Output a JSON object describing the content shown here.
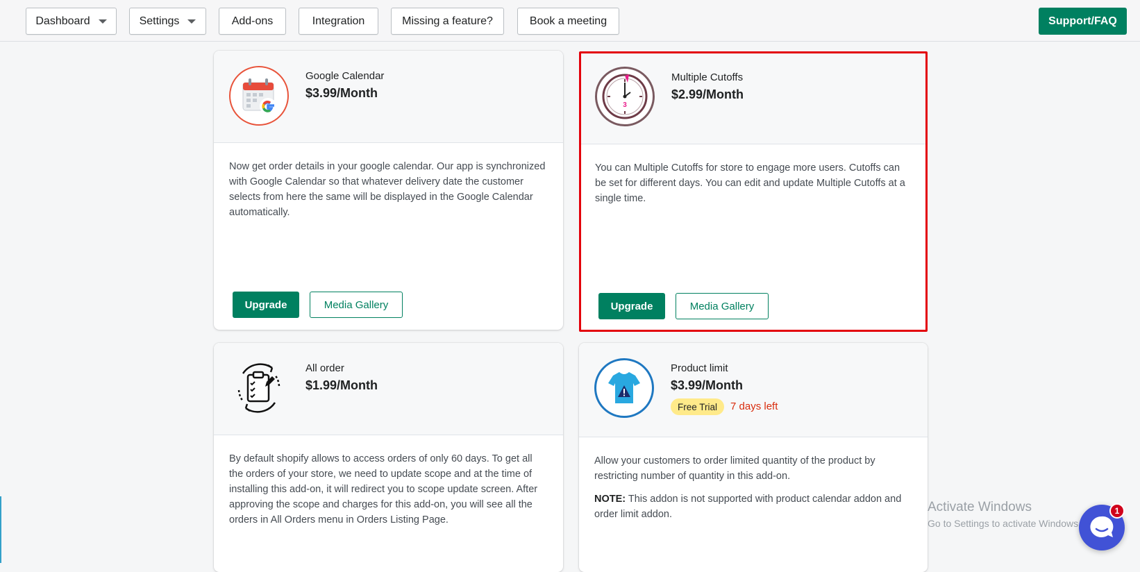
{
  "nav": {
    "dashboard": "Dashboard",
    "settings": "Settings",
    "addons": "Add-ons",
    "integration": "Integration",
    "missing_feature": "Missing a feature?",
    "book_meeting": "Book a meeting",
    "support": "Support/FAQ"
  },
  "cards": [
    {
      "title": "Google Calendar",
      "price": "$3.99/Month",
      "description": "Now get order details in your google calendar. Our app is synchronized with Google Calendar so that whatever delivery date the customer selects from here the same will be displayed in the Google Calendar automatically.",
      "upgrade_label": "Upgrade",
      "media_label": "Media Gallery",
      "icon": "google-calendar-icon"
    },
    {
      "title": "Multiple Cutoffs",
      "price": "$2.99/Month",
      "description": "You can Multiple Cutoffs for store to engage more users. Cutoffs can be set for different days. You can edit and update Multiple Cutoffs at a single time.",
      "upgrade_label": "Upgrade",
      "media_label": "Media Gallery",
      "icon": "clock-icon",
      "clock_number": "3"
    },
    {
      "title": "All order",
      "price": "$1.99/Month",
      "description": "By default shopify allows to access orders of only 60 days. To get all the orders of your store, we need to update scope and at the time of installing this add-on, it will redirect you to scope update screen. After approving the scope and charges for this add-on, you will see all the orders in All Orders menu in Orders Listing Page.",
      "icon": "clipboard-refresh-icon"
    },
    {
      "title": "Product limit",
      "price": "$3.99/Month",
      "badge": "Free Trial",
      "days_left": "7 days left",
      "description": "Allow your customers to order limited quantity of the product by restricting number of quantity in this add-on.",
      "note_label": "NOTE:",
      "note_text": " This addon is not supported with product calendar addon and order limit addon.",
      "icon": "tshirt-warning-icon"
    }
  ],
  "windows": {
    "title": "Activate Windows",
    "subtitle": "Go to Settings to activate Windows."
  },
  "chat": {
    "badge_count": "1",
    "icon": "chat-icon"
  },
  "colors": {
    "primary": "#008060",
    "highlight_border": "#e3000b",
    "trial_badge": "#ffea8a",
    "days_left": "#d82c0d"
  }
}
